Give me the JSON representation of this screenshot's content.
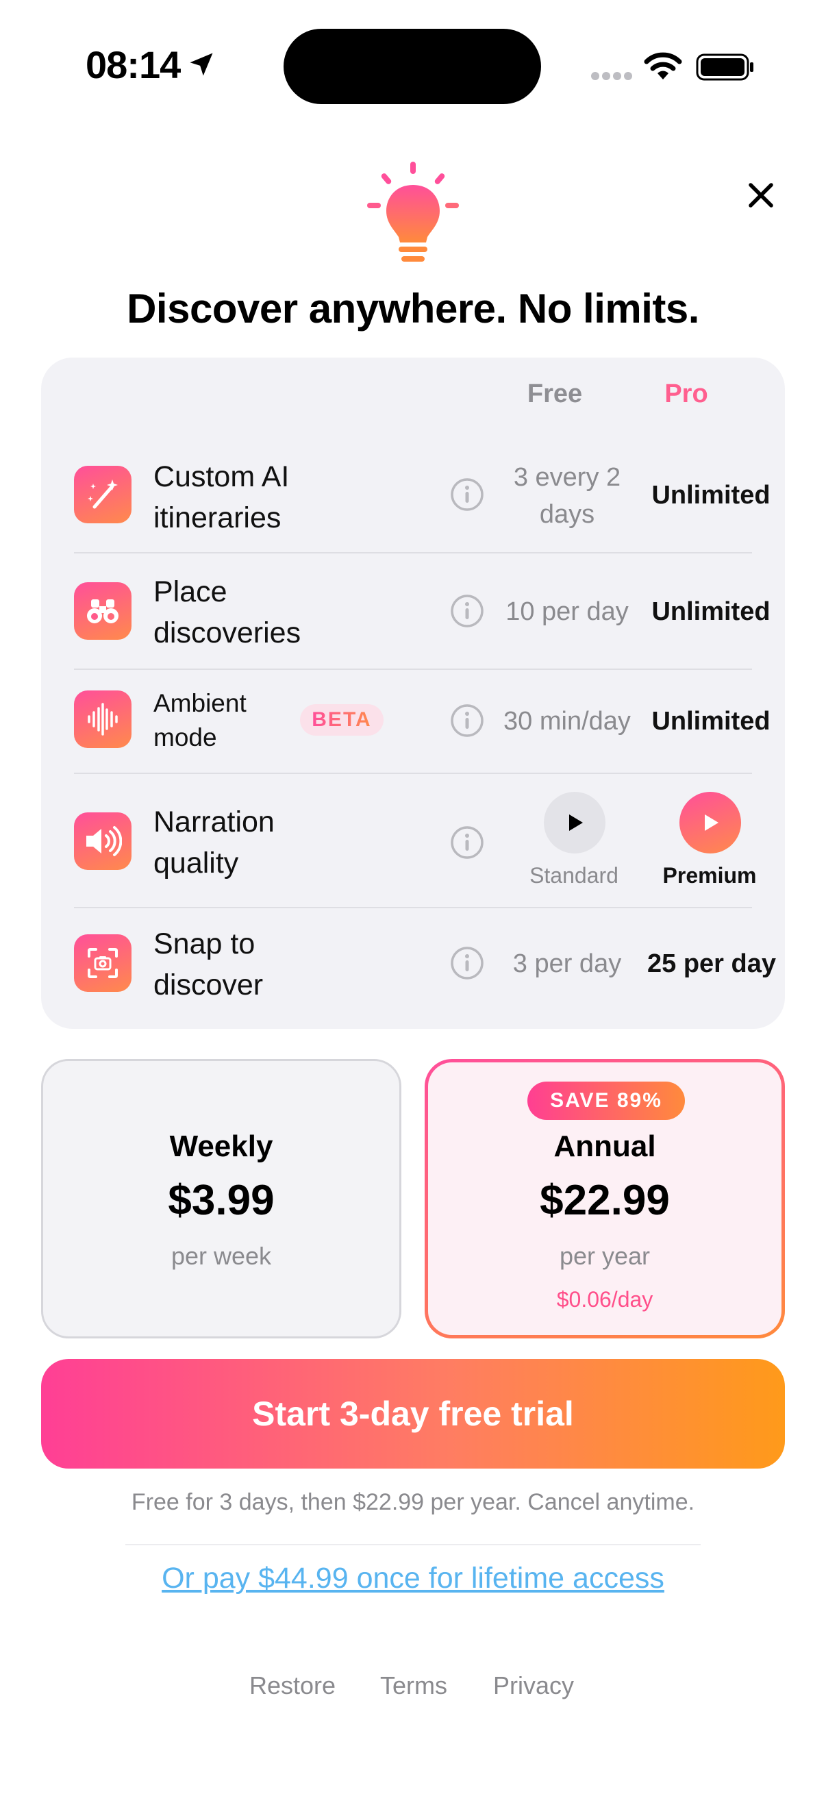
{
  "status_bar": {
    "time": "08:14"
  },
  "headline": "Discover anywhere. No limits.",
  "comparison": {
    "col_free": "Free",
    "col_pro": "Pro",
    "features": [
      {
        "name": "Custom AI itineraries",
        "free": "3 every 2 days",
        "pro": "Unlimited",
        "icon": "magic-wand-icon"
      },
      {
        "name": "Place discoveries",
        "free": "10 per day",
        "pro": "Unlimited",
        "icon": "binoculars-icon"
      },
      {
        "name": "Ambient mode",
        "badge": "BETA",
        "free": "30 min/day",
        "pro": "Unlimited",
        "icon": "waveform-icon"
      },
      {
        "name": "Narration quality",
        "free": "Standard",
        "pro": "Premium",
        "icon": "speaker-icon"
      },
      {
        "name": "Snap to discover",
        "free": "3 per day",
        "pro": "25 per day",
        "icon": "camera-scan-icon"
      }
    ]
  },
  "plans": {
    "weekly": {
      "name": "Weekly",
      "price": "$3.99",
      "period": "per week"
    },
    "annual": {
      "badge": "SAVE 89%",
      "name": "Annual",
      "price": "$22.99",
      "period": "per year",
      "daily": "$0.06/day"
    }
  },
  "cta_label": "Start 3-day free trial",
  "fine_print": "Free for 3 days, then $22.99 per year. Cancel anytime.",
  "lifetime_link": "Or pay $44.99 once for lifetime access",
  "footer": {
    "restore": "Restore",
    "terms": "Terms",
    "privacy": "Privacy"
  },
  "colors": {
    "accent_pink": "#ff4f9a",
    "accent_orange": "#ff8a3c",
    "link_blue": "#58b4f0"
  }
}
